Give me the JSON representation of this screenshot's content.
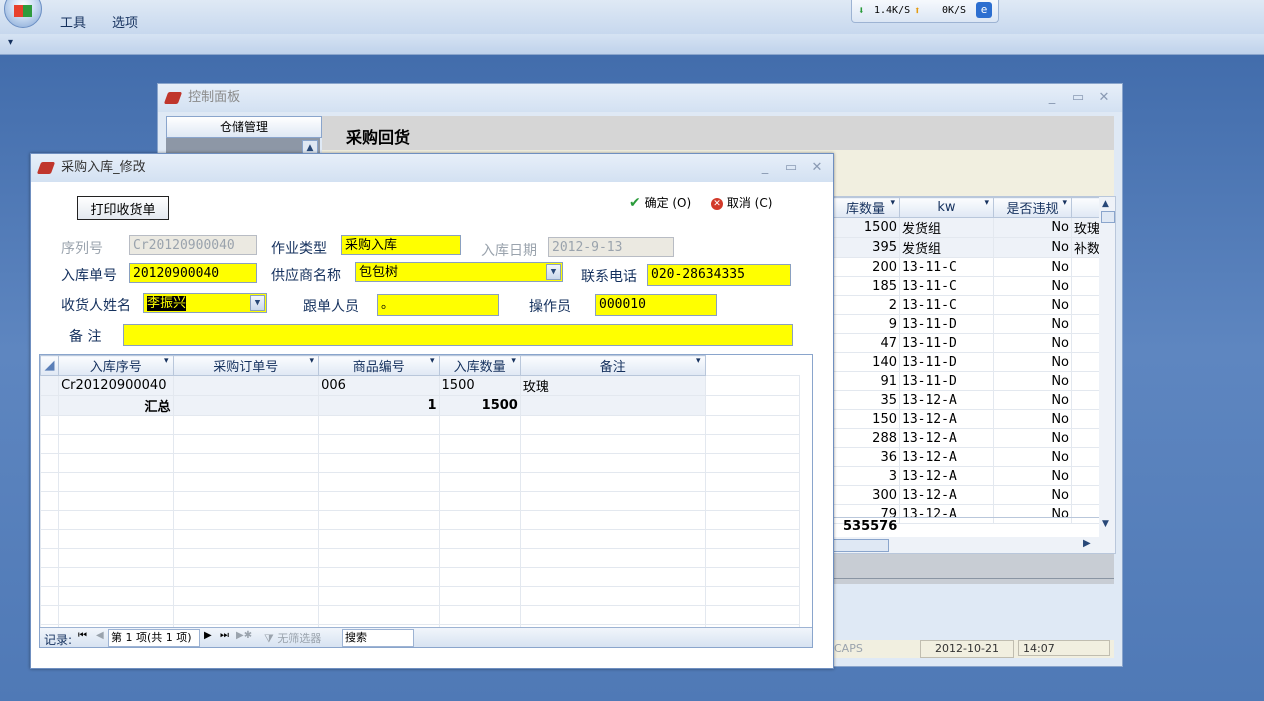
{
  "app": {
    "menu": [
      "工具",
      "选项"
    ],
    "net": {
      "down": "1.4K/S",
      "up": "0K/S"
    },
    "qat_arrow": "▾"
  },
  "control_panel": {
    "title": "控制面板",
    "nav_header": "仓储管理",
    "page_title": "采购回货",
    "grid_headers": [
      "库数量",
      "kw",
      "是否违规"
    ],
    "grid_rows": [
      [
        "1500",
        "发货组",
        "No",
        "玫瑰"
      ],
      [
        "395",
        "发货组",
        "No",
        "补数"
      ],
      [
        "200",
        "13-11-C",
        "No",
        ""
      ],
      [
        "185",
        "13-11-C",
        "No",
        ""
      ],
      [
        "2",
        "13-11-C",
        "No",
        ""
      ],
      [
        "9",
        "13-11-D",
        "No",
        ""
      ],
      [
        "47",
        "13-11-D",
        "No",
        ""
      ],
      [
        "140",
        "13-11-D",
        "No",
        ""
      ],
      [
        "91",
        "13-11-D",
        "No",
        ""
      ],
      [
        "35",
        "13-12-A",
        "No",
        ""
      ],
      [
        "150",
        "13-12-A",
        "No",
        ""
      ],
      [
        "288",
        "13-12-A",
        "No",
        ""
      ],
      [
        "36",
        "13-12-A",
        "No",
        ""
      ],
      [
        "3",
        "13-12-A",
        "No",
        ""
      ],
      [
        "300",
        "13-12-A",
        "No",
        ""
      ],
      [
        "79",
        "13-12-A",
        "No",
        ""
      ]
    ],
    "total": "535576",
    "status": {
      "caps": "CAPS",
      "date": "2012-10-21",
      "time": "14:07"
    }
  },
  "dialog": {
    "title": "采购入库_修改",
    "print_button": "打印收货单",
    "ok_label": "确定 (O)",
    "cancel_label": "取消 (C)",
    "fields": {
      "serial_label": "序列号",
      "serial_value": "Cr20120900040",
      "op_type_label": "作业类型",
      "op_type_value": "采购入库",
      "date_label": "入库日期",
      "date_value": "2012-9-13",
      "order_no_label": "入库单号",
      "order_no_value": "20120900040",
      "supplier_label": "供应商名称",
      "supplier_value": "包包树",
      "phone_label": "联系电话",
      "phone_value": "020-28634335",
      "receiver_label": "收货人姓名",
      "receiver_value": "李振兴",
      "follower_label": "跟单人员",
      "follower_value": "。",
      "operator_label": "操作员",
      "operator_value": "000010",
      "remark_label": "备 注",
      "remark_value": ""
    },
    "grid": {
      "headers": [
        "入库序号",
        "采购订单号",
        "商品编号",
        "入库数量",
        "备注"
      ],
      "rows": [
        [
          "Cr20120900040",
          "",
          "006",
          "1500",
          "玫瑰"
        ]
      ],
      "summary": {
        "label": "汇总",
        "count": "1",
        "qty": "1500"
      }
    },
    "navbar": {
      "record_label": "记录:",
      "position": "第 1 项(共 1 项)",
      "no_filter": "无筛选器",
      "search": "搜索"
    }
  },
  "colors": {
    "required_field": "#ffff00",
    "accent": "#15315e"
  }
}
